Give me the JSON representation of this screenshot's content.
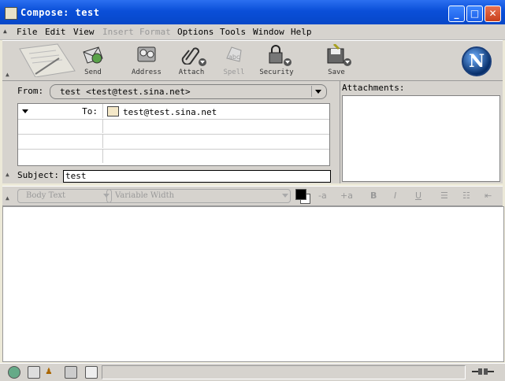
{
  "window": {
    "title": "Compose: test"
  },
  "menubar": {
    "items": [
      {
        "label": "File",
        "disabled": false
      },
      {
        "label": "Edit",
        "disabled": false
      },
      {
        "label": "View",
        "disabled": false
      },
      {
        "label": "Insert",
        "disabled": true
      },
      {
        "label": "Format",
        "disabled": true
      },
      {
        "label": "Options",
        "disabled": false
      },
      {
        "label": "Tools",
        "disabled": false
      },
      {
        "label": "Window",
        "disabled": false
      },
      {
        "label": "Help",
        "disabled": false
      }
    ]
  },
  "toolbar": {
    "send": "Send",
    "address": "Address",
    "attach": "Attach",
    "spell": "Spell",
    "security": "Security",
    "save": "Save",
    "logo_letter": "N"
  },
  "header": {
    "from_label": "From:",
    "from_value": "test <test@test.sina.net>",
    "to_type": "To:",
    "to_value": "test@test.sina.net",
    "subject_label": "Subject:",
    "subject_value": "test",
    "attachments_label": "Attachments:"
  },
  "formatbar": {
    "paragraph_style": "Body Text",
    "font": "Variable Width",
    "smaller": "-a",
    "larger": "+a",
    "bold": "B",
    "italic": "I",
    "underline": "U"
  }
}
